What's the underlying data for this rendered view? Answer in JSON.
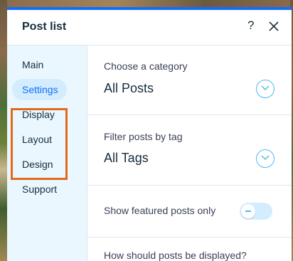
{
  "panel": {
    "title": "Post list",
    "help_icon": "question-mark-icon",
    "close_icon": "close-icon",
    "accent_color": "#116dff"
  },
  "sidebar": {
    "items": [
      {
        "label": "Main",
        "active": false
      },
      {
        "label": "Settings",
        "active": true
      },
      {
        "label": "Display",
        "active": false
      },
      {
        "label": "Layout",
        "active": false
      },
      {
        "label": "Design",
        "active": false
      },
      {
        "label": "Support",
        "active": false
      }
    ],
    "highlight_color": "#e06a1a"
  },
  "content": {
    "category": {
      "label": "Choose a category",
      "value": "All Posts"
    },
    "tag": {
      "label": "Filter posts by tag",
      "value": "All Tags"
    },
    "featured": {
      "label": "Show featured posts only",
      "enabled": false
    },
    "display_question": {
      "label": "How should posts be displayed?"
    }
  }
}
